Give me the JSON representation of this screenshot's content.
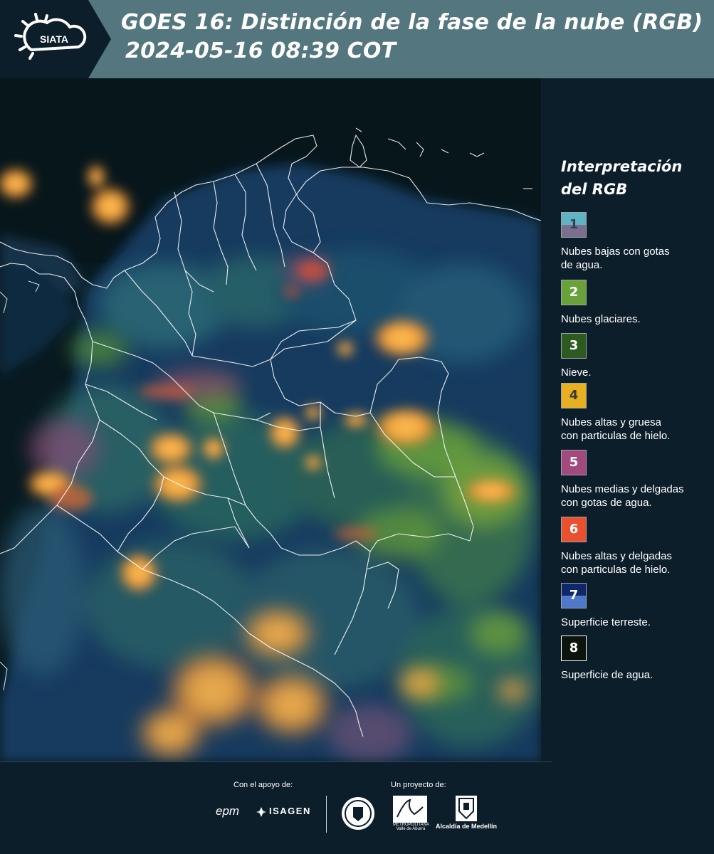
{
  "header": {
    "logo_text": "SIATA",
    "title_line1": "GOES 16: Distinción de la fase de la nube (RGB)",
    "title_line2": "2024-05-16 08:39 COT"
  },
  "legend": {
    "title_line1": "Interpretación",
    "title_line2": "del RGB",
    "items": [
      {
        "num": "1",
        "label_l1": "Nubes bajas con gotas",
        "label_l2": "de agua.",
        "color_top": "#5fb3c2",
        "color_bottom": "#7a6f8e",
        "num_color": "#3a3f55"
      },
      {
        "num": "2",
        "label_l1": "Nubes glaciares.",
        "label_l2": "",
        "color_top": "#6aa23a",
        "color_bottom": "#6aa23a",
        "num_color": "#ffffff"
      },
      {
        "num": "3",
        "label_l1": "Nieve.",
        "label_l2": "",
        "color_top": "#2d5a1e",
        "color_bottom": "#2d5a1e",
        "num_color": "#ffffff"
      },
      {
        "num": "4",
        "label_l1": "Nubes altas y gruesa",
        "label_l2": "con particulas de hielo.",
        "color_top": "#e7b020",
        "color_bottom": "#e7b020",
        "num_color": "#3a3a3a"
      },
      {
        "num": "5",
        "label_l1": "Nubes medias y delgadas",
        "label_l2": "con gotas de agua.",
        "color_top": "#a24a7e",
        "color_bottom": "#a24a7e",
        "num_color": "#ffffff"
      },
      {
        "num": "6",
        "label_l1": "Nubes altas y delgadas",
        "label_l2": "con particulas de hielo.",
        "color_top": "#e8502f",
        "color_bottom": "#e8502f",
        "num_color": "#ffffff"
      },
      {
        "num": "7",
        "label_l1": "Superficie terreste.",
        "label_l2": "",
        "color_top": "#10286a",
        "color_bottom": "#4f78c8",
        "num_color": "#ffffff"
      },
      {
        "num": "8",
        "label_l1": "Superficie de agua.",
        "label_l2": "",
        "color_top": "#0b150c",
        "color_bottom": "#0b150c",
        "num_color": "#ffffff"
      }
    ]
  },
  "footer": {
    "support_label": "Con el apoyo de:",
    "project_label": "Un proyecto de:",
    "sponsor_1": "epm",
    "sponsor_2": "ISAGEN",
    "area_metropolitana": "METROPOLITANA Valle de Aburrá",
    "alcaldia": "Alcaldía de Medellín"
  },
  "colors": {
    "header_bg": "#53767f",
    "logo_band_bg": "#0d1e2b",
    "page_bg": "#0d1e2b",
    "map_water": "#081a20",
    "map_land": "#123a5c",
    "cloud_high_thick": "#f2a23a",
    "cloud_glacier": "#6aa23a"
  }
}
